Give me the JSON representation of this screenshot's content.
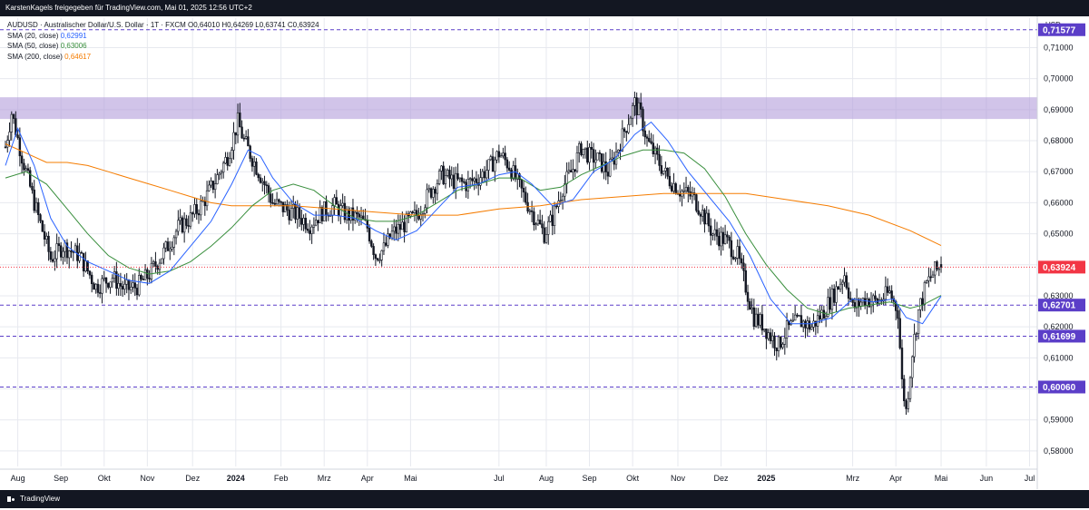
{
  "header": {
    "text": "KarstenKagels freigegeben für TradingView.com, Mai 01, 2025 12:56 UTC+2"
  },
  "footer": {
    "brand": "TradingView"
  },
  "legend": {
    "symbol_line": "AUDUSD · Australischer Dollar/U.S. Dollar · 1T · FXCM  O0,64010  H0,64269  L0,63741  C0,63924",
    "sma20_label": "SMA (20, close)",
    "sma20_value": "0,62991",
    "sma50_label": "SMA (50, close)",
    "sma50_value": "0,63006",
    "sma200_label": "SMA (200, close)",
    "sma200_value": "0,64617"
  },
  "colors": {
    "up": "#131722",
    "down": "#131722",
    "sma20": "#2962ff",
    "sma50": "#388e3c",
    "sma200": "#f57c00",
    "zone": "#b39ddb",
    "level": "#5b3ec8",
    "last_price": "#f23645",
    "grid": "#e7e9ef"
  },
  "chart_data": {
    "type": "candlestick",
    "currency": "USD",
    "ylim": [
      0.575,
      0.7195
    ],
    "yticks": [
      "0,71000",
      "0,70000",
      "0,69000",
      "0,68000",
      "0,67000",
      "0,66000",
      "0,65000",
      "0,64000",
      "0,63000",
      "0,62000",
      "0,61000",
      "0,60000",
      "0,59000",
      "0,58000"
    ],
    "ytick_values": [
      0.71,
      0.7,
      0.69,
      0.68,
      0.67,
      0.66,
      0.65,
      0.64,
      0.63,
      0.62,
      0.61,
      0.6,
      0.59,
      0.58
    ],
    "x_labels": [
      {
        "label": "Aug",
        "t": 6,
        "bold": false
      },
      {
        "label": "Sep",
        "t": 27,
        "bold": false
      },
      {
        "label": "Okt",
        "t": 48,
        "bold": false
      },
      {
        "label": "Nov",
        "t": 69,
        "bold": false
      },
      {
        "label": "Dez",
        "t": 91,
        "bold": false
      },
      {
        "label": "2024",
        "t": 112,
        "bold": true
      },
      {
        "label": "Feb",
        "t": 134,
        "bold": false
      },
      {
        "label": "Mrz",
        "t": 155,
        "bold": false
      },
      {
        "label": "Apr",
        "t": 176,
        "bold": false
      },
      {
        "label": "Mai",
        "t": 197,
        "bold": false
      },
      {
        "label": "Jul",
        "t": 240,
        "bold": false
      },
      {
        "label": "Aug",
        "t": 263,
        "bold": false
      },
      {
        "label": "Sep",
        "t": 284,
        "bold": false
      },
      {
        "label": "Okt",
        "t": 305,
        "bold": false
      },
      {
        "label": "Nov",
        "t": 327,
        "bold": false
      },
      {
        "label": "Dez",
        "t": 348,
        "bold": false
      },
      {
        "label": "2025",
        "t": 370,
        "bold": true
      },
      {
        "label": "Mrz",
        "t": 412,
        "bold": false
      },
      {
        "label": "Apr",
        "t": 433,
        "bold": false
      },
      {
        "label": "Mai",
        "t": 455,
        "bold": false
      },
      {
        "label": "Jun",
        "t": 477,
        "bold": false
      },
      {
        "label": "Jul",
        "t": 498,
        "bold": false
      }
    ],
    "t_range": [
      0,
      500
    ],
    "price_path": [
      [
        0,
        0.678
      ],
      [
        3,
        0.689
      ],
      [
        8,
        0.675
      ],
      [
        14,
        0.66
      ],
      [
        22,
        0.642
      ],
      [
        28,
        0.646
      ],
      [
        36,
        0.643
      ],
      [
        44,
        0.633
      ],
      [
        52,
        0.636
      ],
      [
        58,
        0.632
      ],
      [
        64,
        0.633
      ],
      [
        70,
        0.637
      ],
      [
        78,
        0.645
      ],
      [
        84,
        0.652
      ],
      [
        90,
        0.655
      ],
      [
        96,
        0.66
      ],
      [
        102,
        0.667
      ],
      [
        108,
        0.675
      ],
      [
        113,
        0.686
      ],
      [
        116,
        0.68
      ],
      [
        121,
        0.673
      ],
      [
        126,
        0.666
      ],
      [
        130,
        0.66
      ],
      [
        136,
        0.658
      ],
      [
        142,
        0.656
      ],
      [
        148,
        0.653
      ],
      [
        154,
        0.657
      ],
      [
        160,
        0.659
      ],
      [
        166,
        0.656
      ],
      [
        172,
        0.655
      ],
      [
        176,
        0.652
      ],
      [
        180,
        0.643
      ],
      [
        184,
        0.645
      ],
      [
        188,
        0.65
      ],
      [
        194,
        0.653
      ],
      [
        200,
        0.656
      ],
      [
        206,
        0.663
      ],
      [
        212,
        0.669
      ],
      [
        218,
        0.667
      ],
      [
        224,
        0.666
      ],
      [
        230,
        0.668
      ],
      [
        236,
        0.672
      ],
      [
        240,
        0.676
      ],
      [
        245,
        0.672
      ],
      [
        250,
        0.665
      ],
      [
        256,
        0.657
      ],
      [
        262,
        0.65
      ],
      [
        266,
        0.655
      ],
      [
        271,
        0.665
      ],
      [
        276,
        0.671
      ],
      [
        280,
        0.678
      ],
      [
        284,
        0.675
      ],
      [
        288,
        0.674
      ],
      [
        293,
        0.67
      ],
      [
        297,
        0.676
      ],
      [
        302,
        0.685
      ],
      [
        306,
        0.692
      ],
      [
        309,
        0.688
      ],
      [
        312,
        0.68
      ],
      [
        317,
        0.674
      ],
      [
        322,
        0.668
      ],
      [
        328,
        0.664
      ],
      [
        334,
        0.662
      ],
      [
        338,
        0.658
      ],
      [
        344,
        0.65
      ],
      [
        350,
        0.648
      ],
      [
        356,
        0.643
      ],
      [
        360,
        0.633
      ],
      [
        364,
        0.623
      ],
      [
        368,
        0.621
      ],
      [
        372,
        0.617
      ],
      [
        376,
        0.614
      ],
      [
        380,
        0.619
      ],
      [
        386,
        0.622
      ],
      [
        392,
        0.62
      ],
      [
        398,
        0.625
      ],
      [
        404,
        0.632
      ],
      [
        408,
        0.637
      ],
      [
        412,
        0.626
      ],
      [
        418,
        0.629
      ],
      [
        424,
        0.628
      ],
      [
        430,
        0.631
      ],
      [
        434,
        0.625
      ],
      [
        436,
        0.602
      ],
      [
        438,
        0.593
      ],
      [
        441,
        0.612
      ],
      [
        444,
        0.625
      ],
      [
        448,
        0.634
      ],
      [
        452,
        0.638
      ],
      [
        455,
        0.6392
      ]
    ],
    "sma20_path": [
      [
        0,
        0.672
      ],
      [
        6,
        0.684
      ],
      [
        14,
        0.672
      ],
      [
        22,
        0.655
      ],
      [
        30,
        0.646
      ],
      [
        40,
        0.641
      ],
      [
        50,
        0.638
      ],
      [
        60,
        0.635
      ],
      [
        70,
        0.634
      ],
      [
        80,
        0.638
      ],
      [
        90,
        0.646
      ],
      [
        100,
        0.654
      ],
      [
        110,
        0.666
      ],
      [
        118,
        0.677
      ],
      [
        124,
        0.675
      ],
      [
        130,
        0.668
      ],
      [
        140,
        0.66
      ],
      [
        150,
        0.656
      ],
      [
        160,
        0.656
      ],
      [
        170,
        0.655
      ],
      [
        180,
        0.651
      ],
      [
        190,
        0.648
      ],
      [
        200,
        0.651
      ],
      [
        210,
        0.658
      ],
      [
        220,
        0.665
      ],
      [
        230,
        0.666
      ],
      [
        240,
        0.669
      ],
      [
        248,
        0.67
      ],
      [
        256,
        0.666
      ],
      [
        266,
        0.659
      ],
      [
        276,
        0.661
      ],
      [
        286,
        0.67
      ],
      [
        296,
        0.674
      ],
      [
        306,
        0.682
      ],
      [
        314,
        0.686
      ],
      [
        322,
        0.68
      ],
      [
        332,
        0.67
      ],
      [
        342,
        0.662
      ],
      [
        352,
        0.654
      ],
      [
        362,
        0.643
      ],
      [
        372,
        0.629
      ],
      [
        382,
        0.621
      ],
      [
        392,
        0.621
      ],
      [
        402,
        0.623
      ],
      [
        412,
        0.629
      ],
      [
        422,
        0.628
      ],
      [
        432,
        0.629
      ],
      [
        438,
        0.623
      ],
      [
        446,
        0.621
      ],
      [
        455,
        0.6299
      ]
    ],
    "sma50_path": [
      [
        0,
        0.668
      ],
      [
        10,
        0.67
      ],
      [
        20,
        0.666
      ],
      [
        30,
        0.658
      ],
      [
        40,
        0.65
      ],
      [
        50,
        0.643
      ],
      [
        60,
        0.639
      ],
      [
        70,
        0.637
      ],
      [
        80,
        0.638
      ],
      [
        90,
        0.641
      ],
      [
        100,
        0.646
      ],
      [
        110,
        0.652
      ],
      [
        120,
        0.659
      ],
      [
        130,
        0.664
      ],
      [
        140,
        0.666
      ],
      [
        150,
        0.664
      ],
      [
        160,
        0.659
      ],
      [
        170,
        0.655
      ],
      [
        180,
        0.654
      ],
      [
        190,
        0.654
      ],
      [
        200,
        0.656
      ],
      [
        210,
        0.66
      ],
      [
        220,
        0.664
      ],
      [
        230,
        0.666
      ],
      [
        240,
        0.668
      ],
      [
        250,
        0.668
      ],
      [
        260,
        0.664
      ],
      [
        270,
        0.665
      ],
      [
        280,
        0.669
      ],
      [
        290,
        0.672
      ],
      [
        300,
        0.675
      ],
      [
        310,
        0.677
      ],
      [
        320,
        0.677
      ],
      [
        330,
        0.676
      ],
      [
        340,
        0.671
      ],
      [
        350,
        0.662
      ],
      [
        360,
        0.65
      ],
      [
        370,
        0.64
      ],
      [
        380,
        0.632
      ],
      [
        390,
        0.626
      ],
      [
        400,
        0.624
      ],
      [
        410,
        0.626
      ],
      [
        420,
        0.627
      ],
      [
        430,
        0.628
      ],
      [
        440,
        0.626
      ],
      [
        446,
        0.627
      ],
      [
        455,
        0.6301
      ]
    ],
    "sma200_path": [
      [
        0,
        0.679
      ],
      [
        10,
        0.676
      ],
      [
        20,
        0.673
      ],
      [
        30,
        0.673
      ],
      [
        40,
        0.672
      ],
      [
        50,
        0.67
      ],
      [
        60,
        0.668
      ],
      [
        70,
        0.666
      ],
      [
        80,
        0.664
      ],
      [
        90,
        0.662
      ],
      [
        100,
        0.66
      ],
      [
        110,
        0.659
      ],
      [
        120,
        0.659
      ],
      [
        140,
        0.659
      ],
      [
        160,
        0.658
      ],
      [
        180,
        0.657
      ],
      [
        200,
        0.656
      ],
      [
        220,
        0.656
      ],
      [
        240,
        0.658
      ],
      [
        260,
        0.659
      ],
      [
        280,
        0.661
      ],
      [
        300,
        0.662
      ],
      [
        320,
        0.663
      ],
      [
        340,
        0.663
      ],
      [
        360,
        0.663
      ],
      [
        380,
        0.661
      ],
      [
        400,
        0.659
      ],
      [
        420,
        0.656
      ],
      [
        440,
        0.651
      ],
      [
        455,
        0.6462
      ]
    ],
    "levels": [
      {
        "value": 0.71577,
        "label": "0,71577"
      },
      {
        "value": 0.62701,
        "label": "0,62701"
      },
      {
        "value": 0.61699,
        "label": "0,61699"
      },
      {
        "value": 0.6006,
        "label": "0,60060"
      }
    ],
    "last_price": {
      "value": 0.63924,
      "label": "0,63924"
    },
    "zone": {
      "low": 0.687,
      "high": 0.694
    }
  }
}
